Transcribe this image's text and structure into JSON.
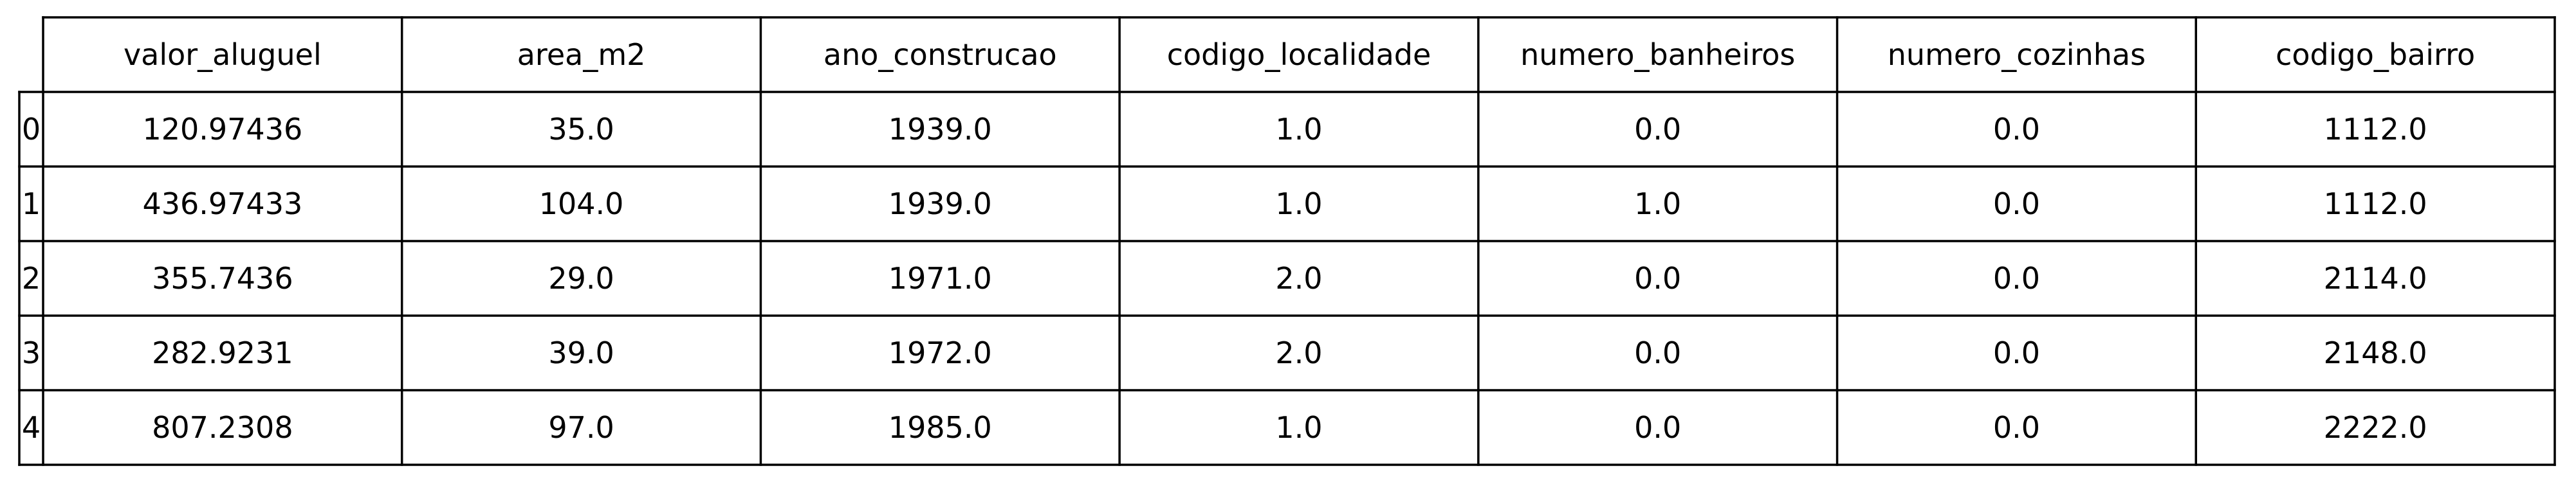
{
  "chart_data": {
    "type": "table",
    "columns": [
      "valor_aluguel",
      "area_m2",
      "ano_construcao",
      "codigo_localidade",
      "numero_banheiros",
      "numero_cozinhas",
      "codigo_bairro"
    ],
    "row_labels": [
      "0",
      "1",
      "2",
      "3",
      "4"
    ],
    "rows": [
      [
        "120.97436",
        "35.0",
        "1939.0",
        "1.0",
        "0.0",
        "0.0",
        "1112.0"
      ],
      [
        "436.97433",
        "104.0",
        "1939.0",
        "1.0",
        "1.0",
        "0.0",
        "1112.0"
      ],
      [
        "355.7436",
        "29.0",
        "1971.0",
        "2.0",
        "0.0",
        "0.0",
        "2114.0"
      ],
      [
        "282.9231",
        "39.0",
        "1972.0",
        "2.0",
        "0.0",
        "0.0",
        "2148.0"
      ],
      [
        "807.2308",
        "97.0",
        "1985.0",
        "1.0",
        "0.0",
        "0.0",
        "2222.0"
      ]
    ]
  }
}
